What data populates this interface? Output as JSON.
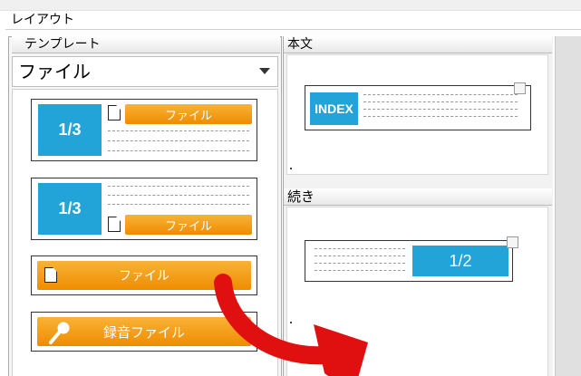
{
  "layout": {
    "title": "レイアウト"
  },
  "templates": {
    "header": "テンプレート",
    "dropdown_value": "ファイル",
    "items": [
      {
        "page_label": "1/3",
        "file_label": "ファイル"
      },
      {
        "page_label": "1/3",
        "file_label": "ファイル"
      },
      {
        "file_label": "ファイル"
      },
      {
        "file_label": "録音ファイル"
      }
    ]
  },
  "body_section": {
    "header": "本文",
    "index_label": "INDEX"
  },
  "continuation_section": {
    "header": "続き",
    "page_label": "1/2"
  },
  "colors": {
    "blue": "#23a4d8",
    "orange": "#f29a10",
    "arrow": "#e01010"
  }
}
